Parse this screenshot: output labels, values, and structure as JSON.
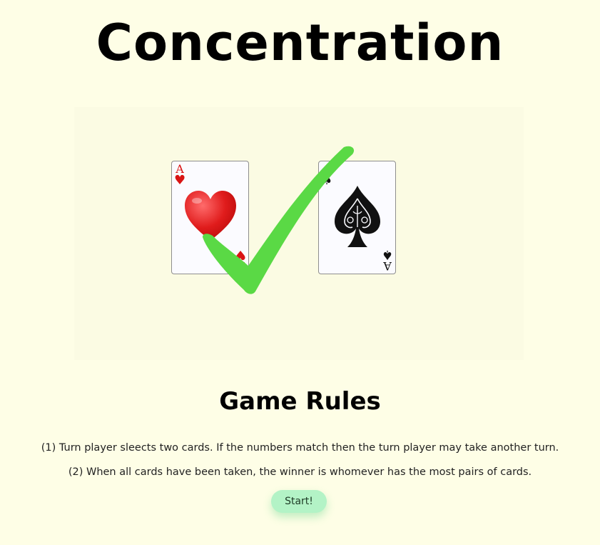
{
  "title": "Concentration",
  "illustration": {
    "cards": [
      {
        "rank": "A",
        "suit": "♥",
        "color": "#d91414"
      },
      {
        "rank": "A",
        "suit": "♠",
        "color": "#111111"
      }
    ],
    "checkmark_color": "#5ad945"
  },
  "rules": {
    "heading": "Game Rules",
    "items": [
      "(1) Turn player sleects two cards. If the numbers match then the turn player may take another turn.",
      "(2) When all cards have been taken, the winner is whomever has the most pairs of cards."
    ]
  },
  "start_button": {
    "label": "Start!",
    "color": "#b3f3c6"
  }
}
